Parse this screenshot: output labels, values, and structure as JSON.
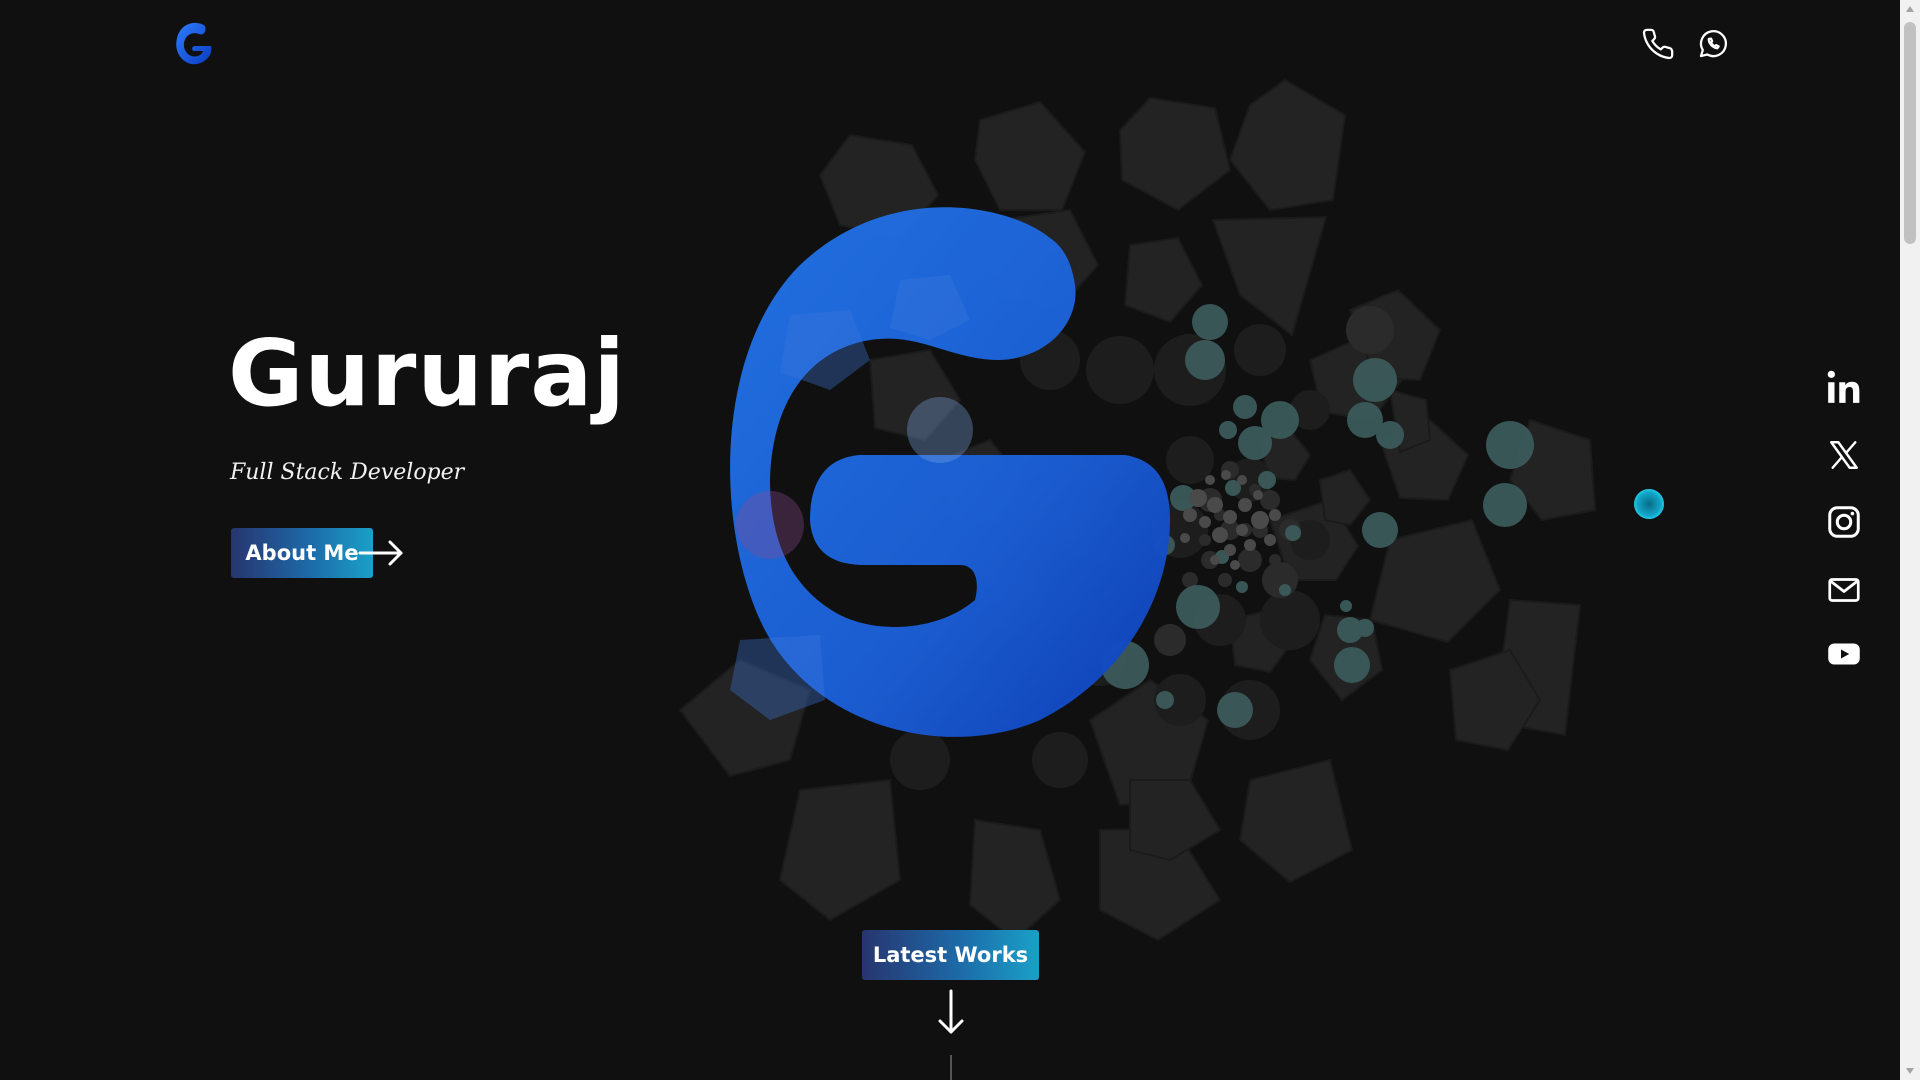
{
  "header": {
    "logo_icon": "g-logo-icon",
    "contact_icons": [
      "phone-icon",
      "whatsapp-icon"
    ]
  },
  "hero": {
    "name": "Gururaj",
    "role": "Full Stack Developer",
    "about_button": "About Me",
    "about_arrow_icon": "arrow-right-icon"
  },
  "latest_works": {
    "label": "Latest Works",
    "arrow_icon": "arrow-down-icon"
  },
  "social_icons": [
    "linkedin-icon",
    "x-icon",
    "instagram-icon",
    "mail-icon",
    "youtube-icon"
  ],
  "colors": {
    "background": "#101010",
    "accent_blue": "#1e63d8",
    "button_gradient_start": "#27356f",
    "button_gradient_end": "#1aa0c7",
    "cursor_teal": "#11a6c9"
  }
}
